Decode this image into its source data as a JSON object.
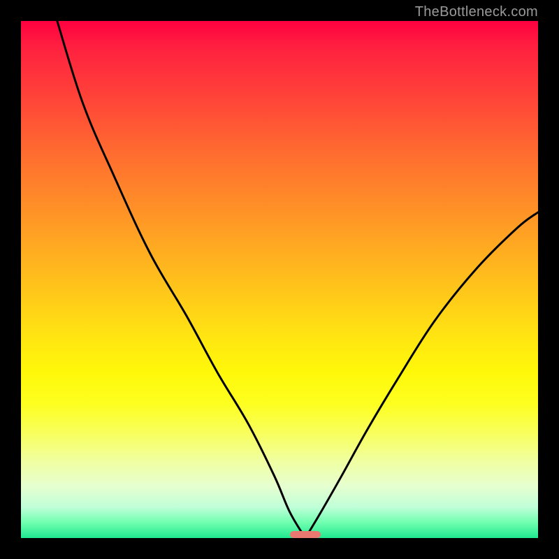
{
  "watermark": "TheBottleneck.com",
  "chart_data": {
    "type": "line",
    "title": "",
    "xlabel": "",
    "ylabel": "",
    "xlim": [
      0,
      100
    ],
    "ylim": [
      0,
      100
    ],
    "background_gradient": {
      "top_color": "#ff0040",
      "mid_color": "#ffe810",
      "bottom_color": "#20e890"
    },
    "marker": {
      "x_center": 55,
      "width_pct": 6,
      "color": "#e87870"
    },
    "series": [
      {
        "name": "left-branch",
        "x": [
          7,
          12,
          18,
          25,
          32,
          38,
          44,
          49,
          52,
          55
        ],
        "values": [
          100,
          84,
          70,
          55,
          43,
          32,
          22,
          12,
          5,
          0
        ]
      },
      {
        "name": "right-branch",
        "x": [
          55,
          58,
          62,
          67,
          73,
          80,
          88,
          96,
          100
        ],
        "values": [
          0,
          5,
          12,
          21,
          31,
          42,
          52,
          60,
          63
        ]
      }
    ]
  }
}
